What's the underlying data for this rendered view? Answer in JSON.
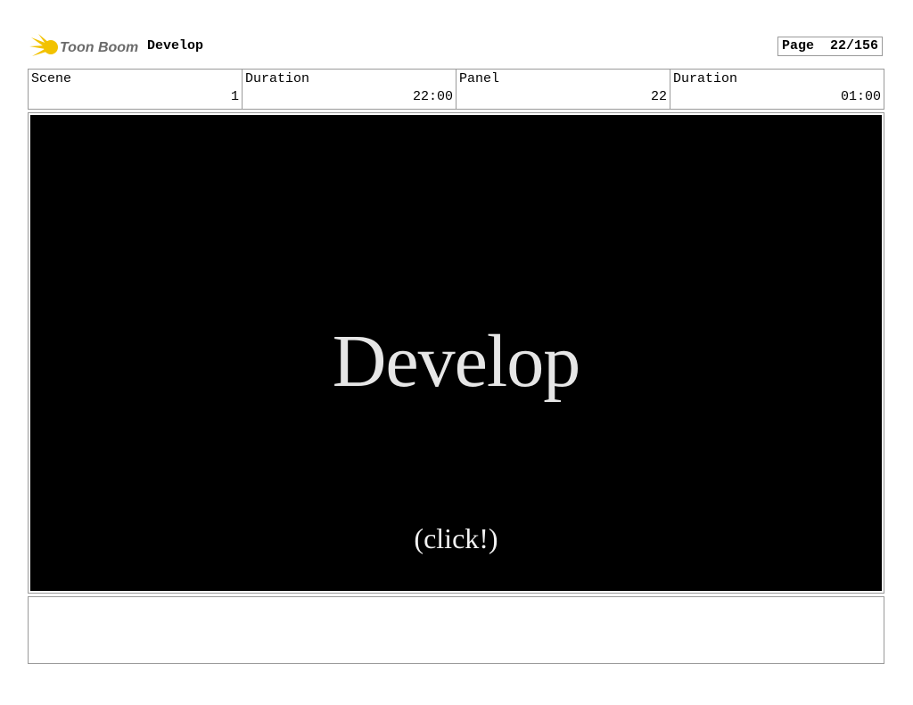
{
  "header": {
    "logo_text": "Toon Boom",
    "project_title": "Develop",
    "page_label": "Page",
    "page_number": "22/156"
  },
  "info": {
    "scene_label": "Scene",
    "scene_value": "1",
    "scene_duration_label": "Duration",
    "scene_duration_value": "22:00",
    "panel_label": "Panel",
    "panel_value": "22",
    "panel_duration_label": "Duration",
    "panel_duration_value": "01:00"
  },
  "panel": {
    "heading": "Develop",
    "caption": "(click!)"
  },
  "notes": {
    "text": ""
  },
  "colors": {
    "border": "#9a9a9a",
    "panel_background": "#000000",
    "logo_yellow": "#f2c200",
    "logo_text": "#6b6b6b"
  },
  "icons": {
    "logo": "toon-boom-logo-icon"
  }
}
